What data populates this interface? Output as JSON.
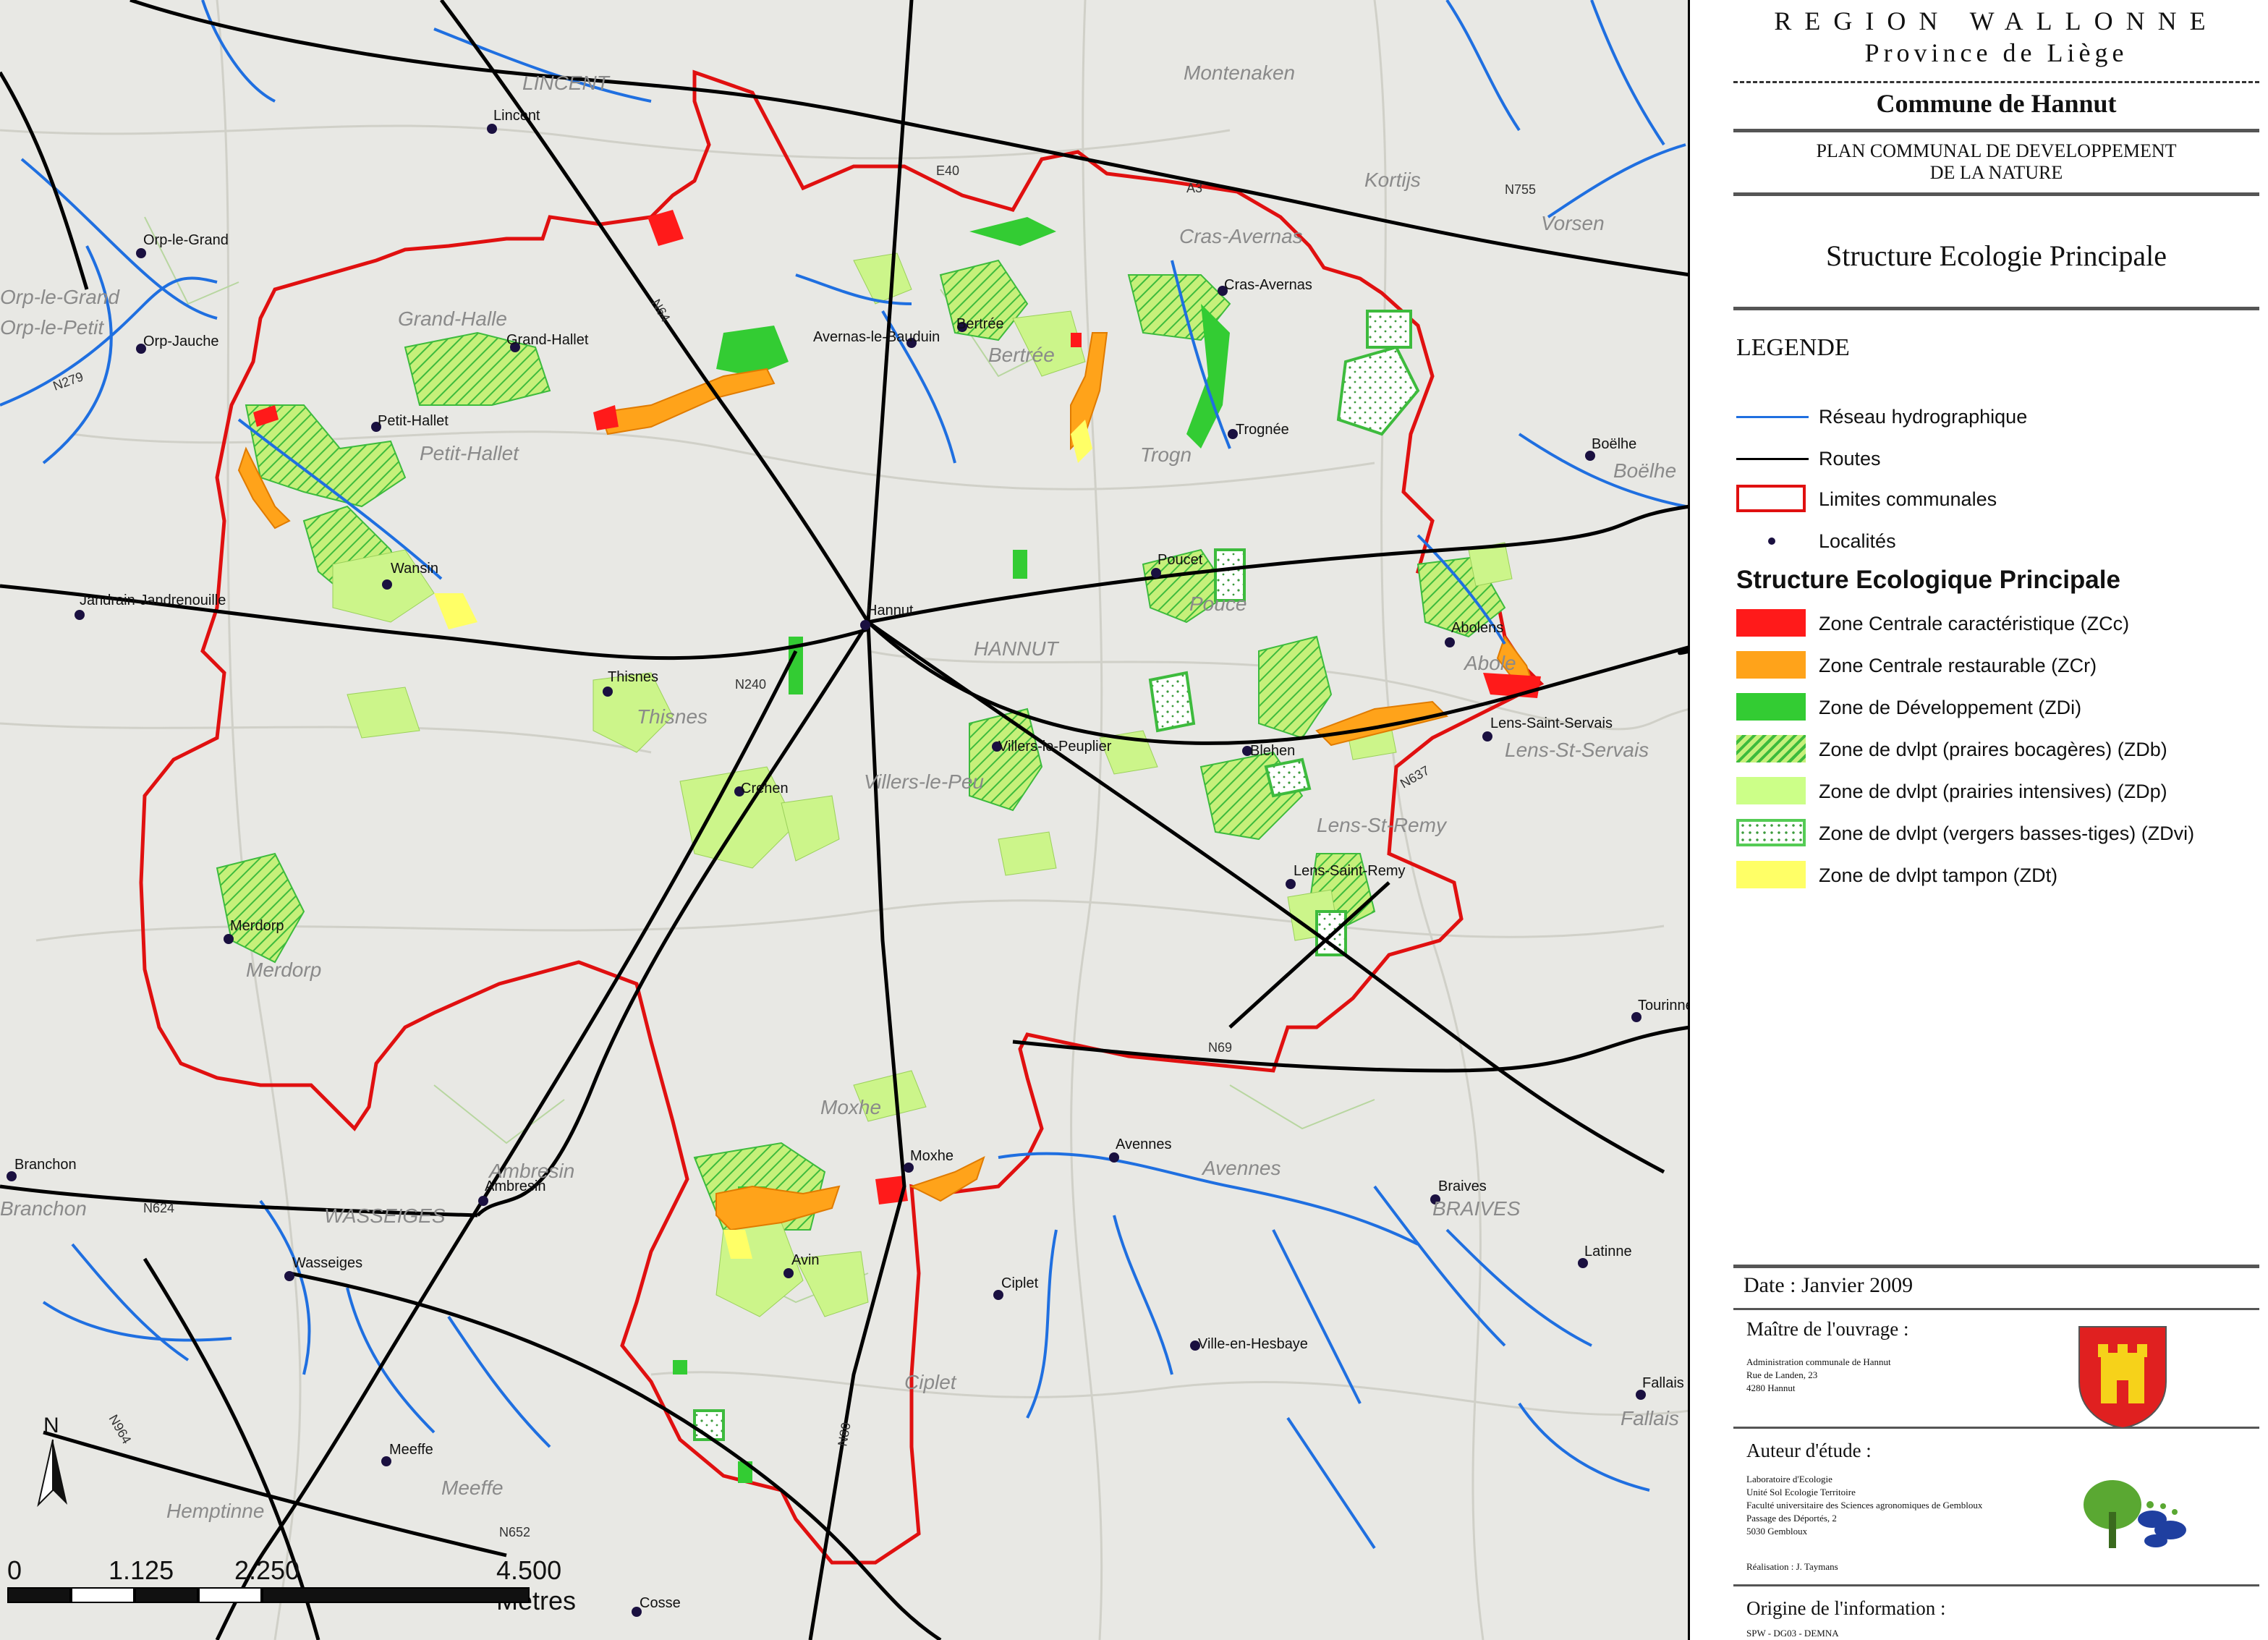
{
  "header": {
    "region": "REGION WALLONNE",
    "province": "Province de Liège",
    "commune": "Commune de Hannut",
    "plan_line1": "PLAN COMMUNAL DE DEVELOPPEMENT",
    "plan_line2": "DE LA NATURE",
    "title": "Structure Ecologie Principale"
  },
  "legend": {
    "title": "LEGENDE",
    "base_items": [
      {
        "label": "Réseau hydrographique",
        "color": "#1f6fe0"
      },
      {
        "label": "Routes",
        "color": "#000000"
      },
      {
        "label": "Limites communales",
        "color": "#e01010"
      },
      {
        "label": "Localités",
        "color": "#1a1040"
      }
    ],
    "sep_title": "Structure Ecologique Principale",
    "sep_items": [
      {
        "label": "Zone Centrale caractéristique (ZCc)",
        "color": "#ff1a1a"
      },
      {
        "label": "Zone Centrale restaurable (ZCr)",
        "color": "#ffa31a"
      },
      {
        "label": "Zone de Développement (ZDi)",
        "color": "#33cc33"
      },
      {
        "label": "Zone de dvlpt (praires bocagères) (ZDb)",
        "color": "#b2ee55"
      },
      {
        "label": "Zone de dvlpt (prairies intensives) (ZDp)",
        "color": "#ccff88"
      },
      {
        "label": "Zone de dvlpt (vergers basses-tiges) (ZDvi)",
        "color": "#55cc55"
      },
      {
        "label": "Zone de dvlpt tampon (ZDt)",
        "color": "#ffff66"
      }
    ]
  },
  "footer": {
    "date": "Date :  Janvier 2009",
    "maitre_title": "Maître de l'ouvrage :",
    "maitre_lines": [
      "Administration communale de Hannut",
      "Rue de Landen, 23",
      "4280 Hannut"
    ],
    "auteur_title": "Auteur d'étude :",
    "auteur_lines": [
      "Laboratoire d'Ecologie",
      "Unité Sol Ecologie Territoire",
      "Faculté universitaire des Sciences agronomiques de Gembloux",
      "Passage des Déportés, 2",
      "5030 Gembloux"
    ],
    "realisation": "Réalisation : J. Taymans",
    "origine_title": "Origine de l'information :",
    "origine_text": "SPW - DG03 - DEMNA"
  },
  "scale": {
    "ticks": [
      "0",
      "1.125",
      "2.250",
      "4.500 Mètres"
    ]
  },
  "north_label": "N",
  "map": {
    "localities": [
      "Lincent",
      "Orp-le-Grand",
      "Orp-Jauche",
      "Grand-Hallet",
      "Petit-Hallet",
      "Wansin",
      "Jandrain-Jandrenouille",
      "Thisnes",
      "Hannut",
      "Avernas-le-Bauduin",
      "Bertrée",
      "Cras-Avernas",
      "Trognée",
      "Poucet",
      "Abolens",
      "Lens-Saint-Servais",
      "Blehen",
      "Villers-le-Peuplier",
      "Crehen",
      "Lens-Saint-Remy",
      "Merdorp",
      "Boëlhe",
      "Tourinne",
      "Moxhe",
      "Avin",
      "Avennes",
      "Braives",
      "Ciplet",
      "Ville-en-Hesbaye",
      "Latinne",
      "Fallais",
      "Branchon",
      "Ambresin",
      "Wasseiges",
      "Meeffe",
      "Cosse"
    ],
    "area_labels": [
      "LINCENT",
      "Montenaken",
      "Kortijs",
      "Vorsen",
      "Grand-Halle",
      "Petit-Hallet",
      "Orp-le-Grand",
      "Orp-le-Petit",
      "HANNUT",
      "Cras-Avernas",
      "Trogn",
      "Pouce",
      "Abole",
      "Lens-St-Servais",
      "Villers-le-Peu",
      "Merdorp",
      "Moxhe",
      "Avennes",
      "BRAIVES",
      "Ciplet",
      "WASSEIGES",
      "Ambresin",
      "Meeffe",
      "Hemptinne",
      "Branchon",
      "Fallais",
      "Boëlhe",
      "Bertrée",
      "Lens-St-Remy",
      "Thisnes"
    ],
    "road_labels": [
      "N64",
      "N80",
      "N240",
      "N69",
      "N637",
      "N755",
      "A3",
      "N279",
      "N624",
      "N964",
      "N652",
      "E40"
    ]
  }
}
